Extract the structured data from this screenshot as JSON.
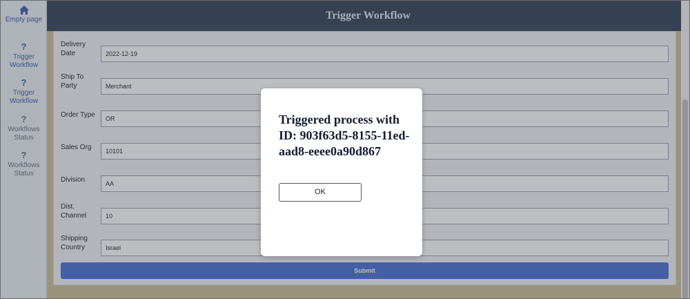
{
  "sidebar": {
    "items": [
      {
        "label": "Empty page",
        "icon": "home-icon"
      },
      {
        "label": "Trigger Workflow",
        "icon": "question-icon"
      },
      {
        "label": "Trigger Workflow",
        "icon": "question-icon"
      },
      {
        "label": "Workflows Status",
        "icon": "question-icon"
      },
      {
        "label": "Workflows Status",
        "icon": "question-icon"
      }
    ]
  },
  "header": {
    "title": "Trigger Workflow"
  },
  "form": {
    "fields": [
      {
        "label": "Delivery Date",
        "value": "2022-12-19"
      },
      {
        "label": "Ship To Party",
        "value": "Merchant"
      },
      {
        "label": "Order Type",
        "value": "OR"
      },
      {
        "label": "Sales Org",
        "value": "10101"
      },
      {
        "label": "Division",
        "value": "AA"
      },
      {
        "label": "Dist. Channel",
        "value": "10"
      },
      {
        "label": "Shipping Country",
        "value": "Israel"
      }
    ],
    "submit_label": "Submit"
  },
  "modal": {
    "message": "Triggered process with ID: 903f63d5-8155-11ed-aad8-eeee0a90d867",
    "ok_label": "OK"
  },
  "colors": {
    "header_bg": "#334157",
    "accent": "#4a6fd4",
    "nav_active": "#3d5aa8"
  }
}
